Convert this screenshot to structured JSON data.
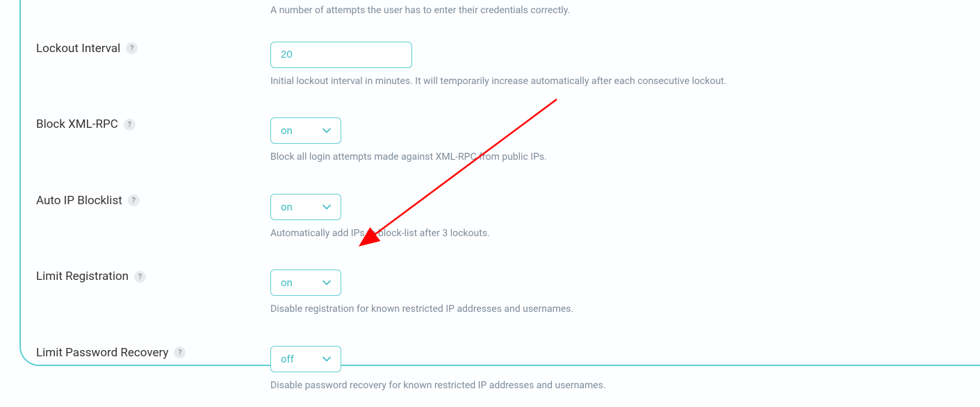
{
  "colors": {
    "accent": "#5fd0d4",
    "accent_text": "#3bbcc0",
    "muted": "#7d8b99",
    "label": "#333333"
  },
  "fields": {
    "attempts": {
      "desc": "A number of attempts the user has to enter their credentials correctly."
    },
    "lockout_interval": {
      "label": "Lockout Interval",
      "value": "20",
      "desc": "Initial lockout interval in minutes. It will temporarily increase automatically after each consecutive lockout."
    },
    "block_xmlrpc": {
      "label": "Block XML-RPC",
      "value": "on",
      "desc": "Block all login attempts made against XML-RPC from public IPs."
    },
    "auto_ip_blocklist": {
      "label": "Auto IP Blocklist",
      "value": "on",
      "desc": "Automatically add IPs to block-list after 3 lockouts."
    },
    "limit_registration": {
      "label": "Limit Registration",
      "value": "on",
      "desc": "Disable registration for known restricted IP addresses and usernames."
    },
    "limit_password_recovery": {
      "label": "Limit Password Recovery",
      "value": "off",
      "desc": "Disable password recovery for known restricted IP addresses and usernames."
    }
  },
  "help_symbol": "?"
}
